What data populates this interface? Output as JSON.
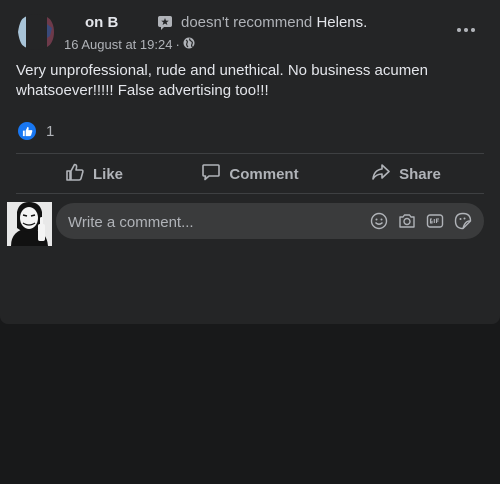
{
  "post": {
    "author": "on B",
    "recommend_text": "doesn't recommend",
    "page_name": "Helens.",
    "timestamp": "16 August at 19:24",
    "separator": "·",
    "body": "Very unprofessional, rude and unethical. No business acumen whatsoever!!!!! False advertising too!!!",
    "reaction_count": "1"
  },
  "actions": {
    "like": "Like",
    "comment": "Comment",
    "share": "Share"
  },
  "comment_box": {
    "placeholder": "Write a comment..."
  },
  "icons": [
    "flag-star-icon",
    "globe-icon",
    "more-icon",
    "like-reaction-icon",
    "thumb-up-icon",
    "comment-icon",
    "share-icon",
    "emoji-icon",
    "camera-icon",
    "gif-icon",
    "sticker-icon"
  ],
  "colors": {
    "background": "#18191a",
    "card": "#242526",
    "accent": "#1877f2",
    "secondary_text": "#b0b3b8",
    "primary_text": "#e4e6eb"
  }
}
